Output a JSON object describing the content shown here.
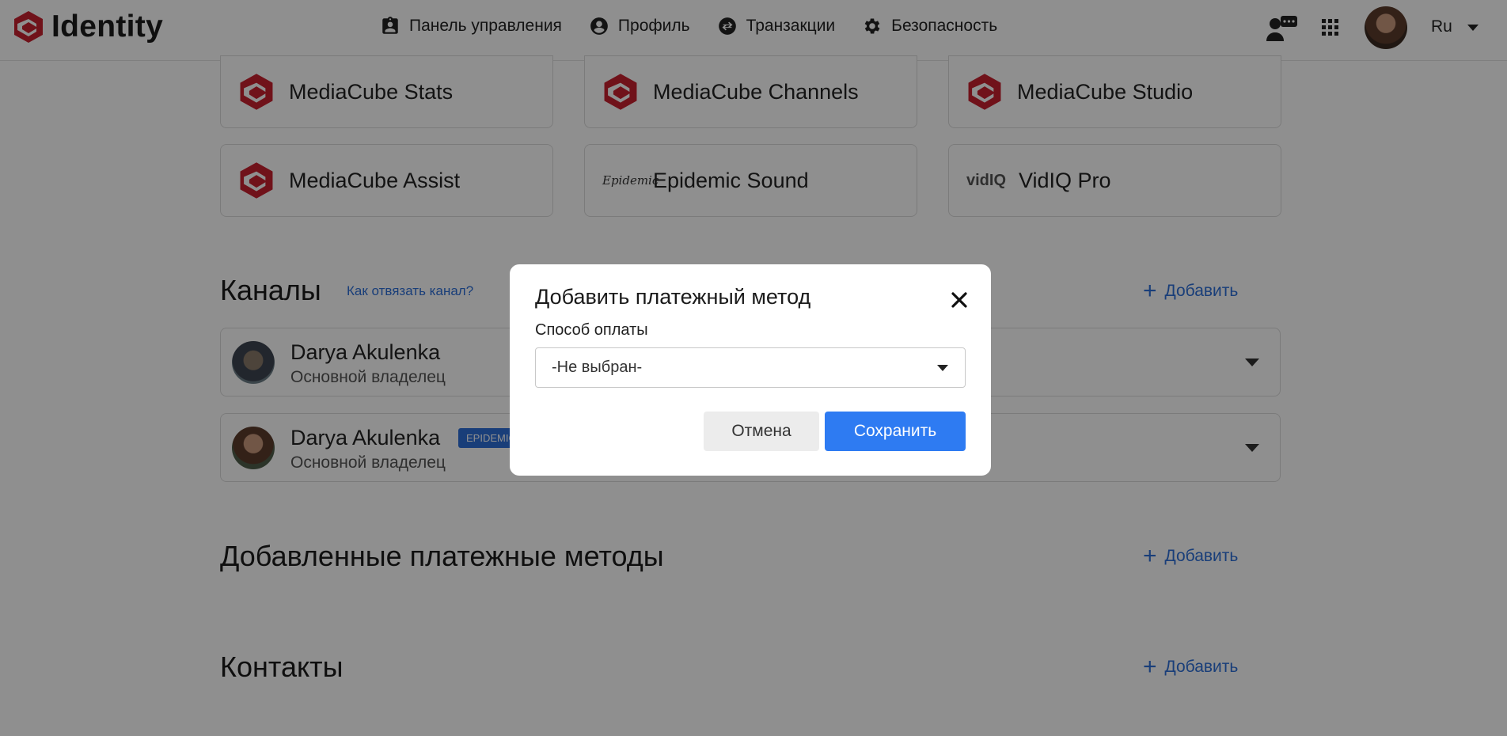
{
  "header": {
    "logo_text": "Identity",
    "nav": [
      {
        "label": "Панель управления",
        "icon": "clipboard-person-icon"
      },
      {
        "label": "Профиль",
        "icon": "account-circle-icon"
      },
      {
        "label": "Транзакции",
        "icon": "swap-arrows-icon"
      },
      {
        "label": "Безопасность",
        "icon": "gear-icon"
      }
    ],
    "language": "Ru"
  },
  "services": [
    {
      "name": "MediaCube Stats"
    },
    {
      "name": "MediaCube Channels"
    },
    {
      "name": "MediaCube Studio"
    },
    {
      "name": "MediaCube Assist"
    },
    {
      "name": "Epidemic Sound",
      "logo_text": "Epidemic"
    },
    {
      "name": "VidIQ Pro",
      "logo_text": "vidIQ"
    }
  ],
  "channels_section": {
    "title": "Каналы",
    "help_link": "Как отвязать канал?",
    "add_label": "Добавить",
    "items": [
      {
        "name": "Darya Akulenka",
        "role": "Основной владелец",
        "badge": ""
      },
      {
        "name": "Darya Akulenka",
        "role": "Основной владелец",
        "badge": "EPIDEMIC"
      }
    ]
  },
  "payment_section": {
    "title": "Добавленные платежные методы",
    "add_label": "Добавить"
  },
  "contacts_section": {
    "title": "Контакты",
    "add_label": "Добавить"
  },
  "modal": {
    "title": "Добавить платежный метод",
    "field_label": "Способ оплаты",
    "select_value": "-Не выбран-",
    "cancel_label": "Отмена",
    "save_label": "Сохранить"
  },
  "colors": {
    "brand_red": "#c8202f",
    "accent_blue": "#2e7bf2",
    "link_blue": "#2e6fd8"
  }
}
